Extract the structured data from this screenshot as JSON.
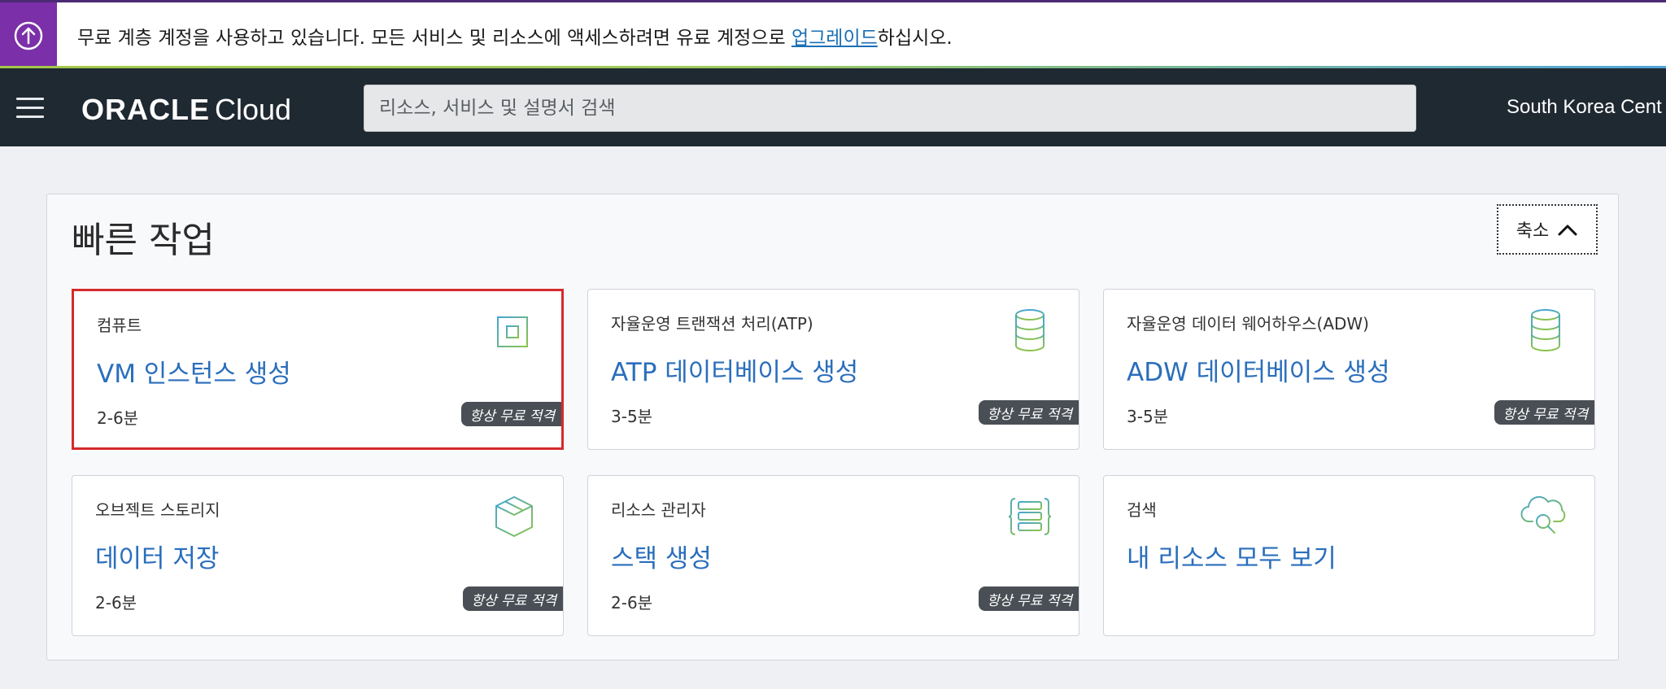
{
  "banner": {
    "text_before": "무료 계층 계정을 사용하고 있습니다. 모든 서비스 및 리소스에 액세스하려면 유료 계정으로 ",
    "link": "업그레이드",
    "text_after": "하십시오."
  },
  "header": {
    "logo_oracle": "ORACLE",
    "logo_cloud": "Cloud",
    "search_placeholder": "리소스, 서비스 및 설명서 검색",
    "region": "South Korea Cent"
  },
  "quick_actions": {
    "title": "빠른 작업",
    "collapse_label": "축소",
    "cards": [
      {
        "category": "컴퓨트",
        "title": "VM 인스턴스 생성",
        "time": "2-6분",
        "badge": "항상 무료 적격",
        "icon": "chip-icon"
      },
      {
        "category": "자율운영 트랜잭션 처리(ATP)",
        "title": "ATP 데이터베이스 생성",
        "time": "3-5분",
        "badge": "항상 무료 적격",
        "icon": "database-icon"
      },
      {
        "category": "자율운영 데이터 웨어하우스(ADW)",
        "title": "ADW 데이터베이스 생성",
        "time": "3-5분",
        "badge": "항상 무료 적격",
        "icon": "database-icon"
      },
      {
        "category": "오브젝트 스토리지",
        "title": "데이터 저장",
        "time": "2-6분",
        "badge": "항상 무료 적격",
        "icon": "box-icon"
      },
      {
        "category": "리소스 관리자",
        "title": "스택 생성",
        "time": "2-6분",
        "badge": "항상 무료 적격",
        "icon": "stack-icon"
      },
      {
        "category": "검색",
        "title": "내 리소스 모두 보기",
        "icon": "cloud-search-icon"
      }
    ]
  },
  "colors": {
    "banner_accent": "#7b2fa8",
    "header_bg": "#1f2932",
    "link": "#2a6ebc",
    "selected_border": "#d52b2b",
    "badge_bg": "#4a4f55"
  }
}
